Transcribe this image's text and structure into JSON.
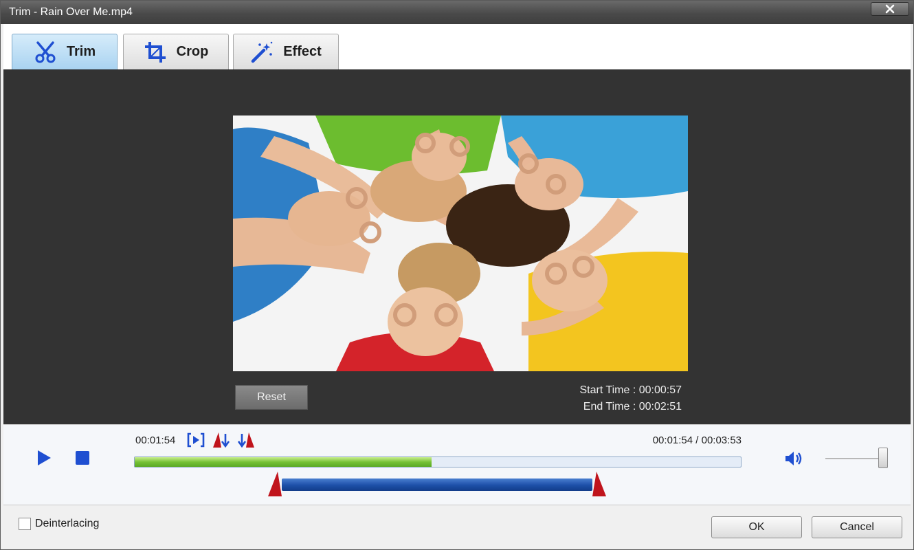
{
  "window": {
    "title": "Trim - Rain Over Me.mp4",
    "close_icon": "close-icon"
  },
  "tabs": [
    {
      "label": "Trim",
      "icon": "scissors-icon",
      "active": true
    },
    {
      "label": "Crop",
      "icon": "crop-icon",
      "active": false
    },
    {
      "label": "Effect",
      "icon": "magic-wand-icon",
      "active": false
    }
  ],
  "preview": {
    "reset_label": "Reset",
    "start_time": "Start Time : 00:00:57",
    "end_time": "End Time : 00:02:51"
  },
  "player": {
    "current_time": "00:01:54",
    "position_display": "00:01:54 / 00:03:53",
    "progress_fraction": 0.49,
    "trim_start_fraction": 0.243,
    "trim_end_fraction": 0.755,
    "volume_fraction": 0.95,
    "icons": [
      "play-icon",
      "stop-icon",
      "play-selection-icon",
      "set-start-icon",
      "set-end-icon",
      "volume-icon"
    ]
  },
  "footer": {
    "deinterlacing_label": "Deinterlacing",
    "deinterlacing_checked": false,
    "ok_label": "OK",
    "cancel_label": "Cancel"
  },
  "colors": {
    "accent_blue": "#1f4fd1",
    "marker_red": "#c0141c",
    "progress_green": "#76c236",
    "range_blue": "#1d4fa8"
  }
}
